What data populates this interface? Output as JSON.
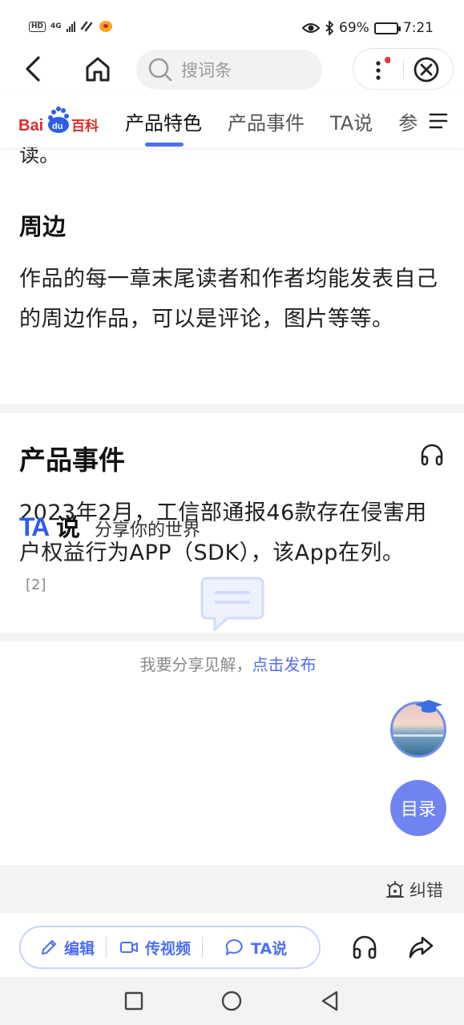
{
  "status_bar": {
    "hd": "HD",
    "network": "4G",
    "battery_percent": "69%",
    "battery_level": 0.69,
    "time": "7:21"
  },
  "nav": {
    "search_placeholder": "搜词条"
  },
  "tab_bar": {
    "logo_text": "Bai du 百科",
    "tabs": [
      "产品特色",
      "产品事件",
      "TA说",
      "参"
    ],
    "active_tab": 0
  },
  "article": {
    "top_fragment": "读。",
    "section_peripheral": {
      "title": "周边",
      "body": "作品的每一章末尾读者和作者均能发表自己的周边作品，可以是评论，图片等等。"
    },
    "section_events": {
      "title": "产品事件",
      "body": "2023年2月，工信部通报46款存在侵害用户权益行为APP（SDK），该App在列。",
      "citation": "[2]"
    }
  },
  "ta_shuo": {
    "logo": "TA说",
    "slogan": "分享你的世界",
    "empty_text": "我要分享见解，",
    "empty_link": "点击发布"
  },
  "floating": {
    "toc_label": "目录"
  },
  "report": {
    "label": "纠错"
  },
  "toolbar": {
    "edit_label": "编辑",
    "video_label": "传视频",
    "ta_label": "TA说"
  },
  "colors": {
    "accent": "#4e6ef2",
    "baidu_red": "#de2b2b",
    "baidu_blue": "#2d5ee8"
  }
}
